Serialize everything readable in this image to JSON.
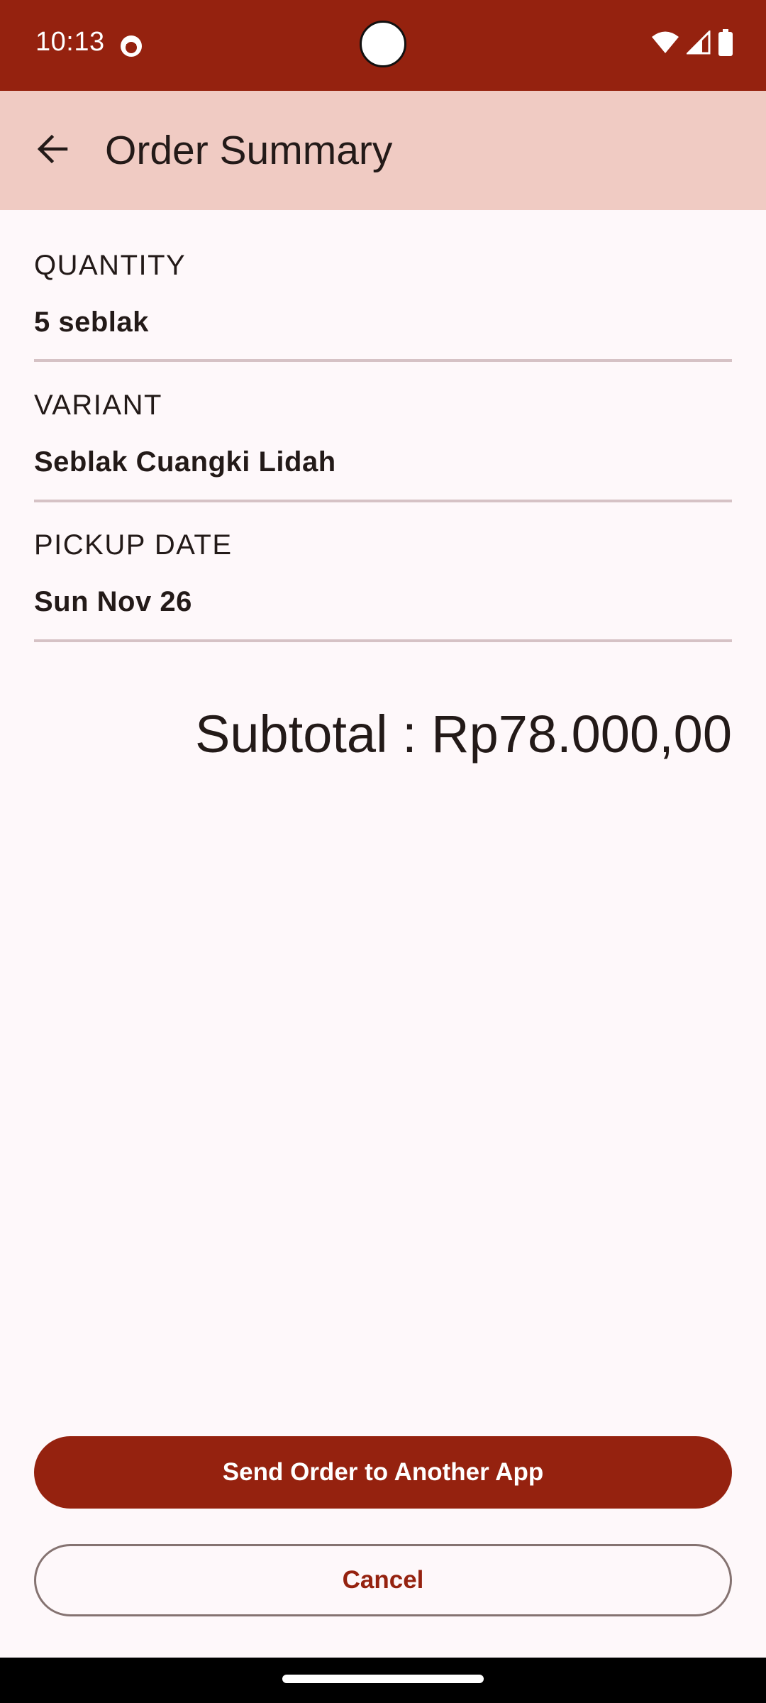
{
  "status_bar": {
    "time": "10:13",
    "background": "#95220f",
    "icons": [
      "app-notification-icon",
      "wifi-icon",
      "signal-icon",
      "battery-icon"
    ]
  },
  "app_bar": {
    "title": "Order Summary",
    "back_icon": "arrow-back-icon",
    "background": "#f0cbc3"
  },
  "summary": {
    "fields": [
      {
        "label": "QUANTITY",
        "value": "5 seblak"
      },
      {
        "label": "VARIANT",
        "value": "Seblak Cuangki Lidah"
      },
      {
        "label": "PICKUP DATE",
        "value": "Sun Nov 26"
      }
    ],
    "subtotal": "Subtotal : Rp78.000,00"
  },
  "actions": {
    "send_label": "Send Order to Another App",
    "cancel_label": "Cancel"
  },
  "colors": {
    "primary": "#95220f",
    "surface": "#fef8fa",
    "divider": "#d6c2c5",
    "outline": "#857371"
  }
}
